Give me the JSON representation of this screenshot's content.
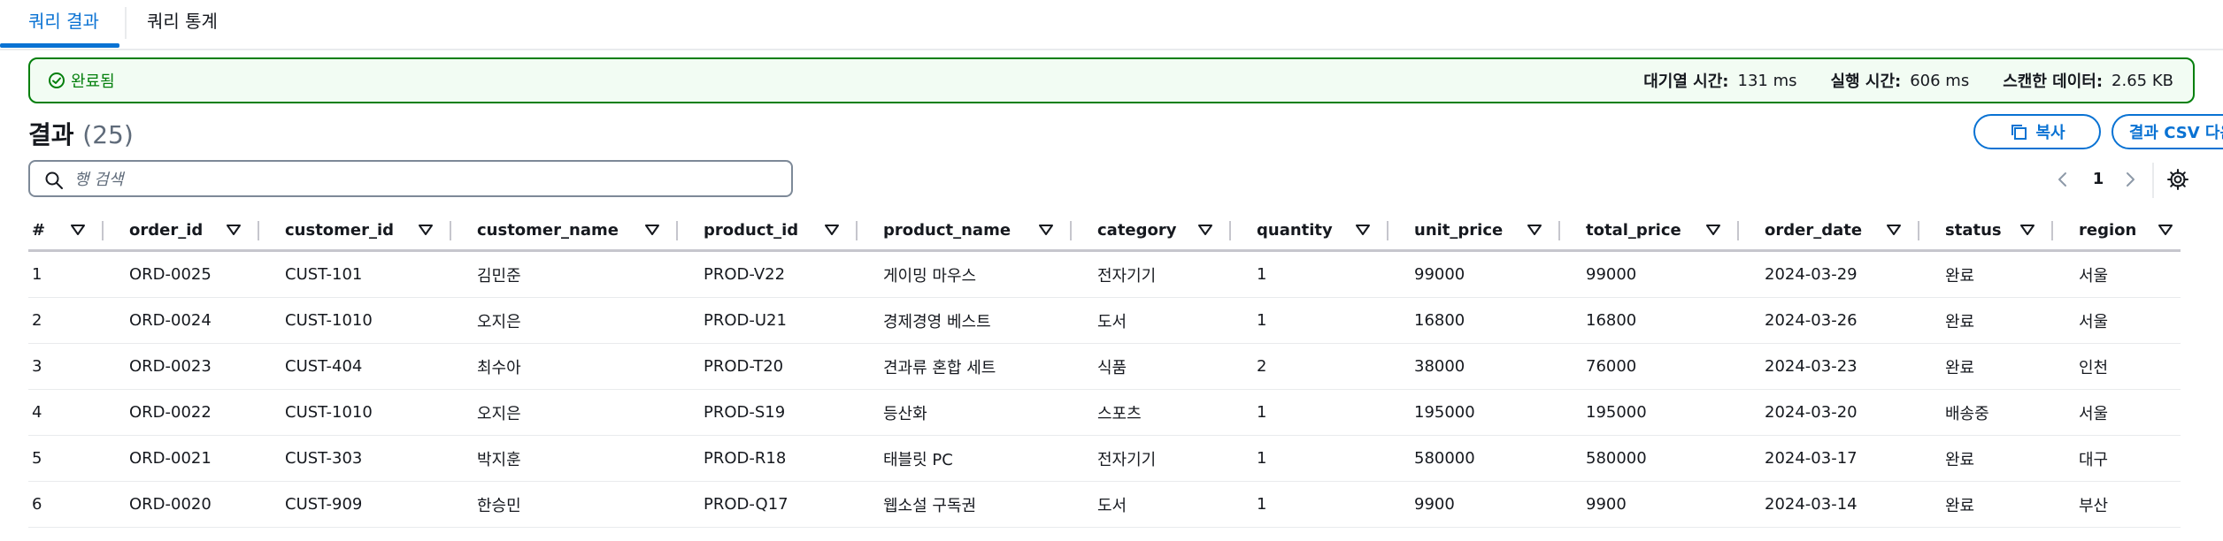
{
  "tabs": [
    {
      "label": "쿼리 결과",
      "active": true
    },
    {
      "label": "쿼리 통계",
      "active": false
    }
  ],
  "status": {
    "text": "완료됨",
    "queue_label": "대기열 시간:",
    "queue_value": "131 ms",
    "run_label": "실행 시간:",
    "run_value": "606 ms",
    "scan_label": "스캔한 데이터:",
    "scan_value": "2.65 KB",
    "color": "#037f0c"
  },
  "results": {
    "title": "결과",
    "count": "(25)",
    "copy_label": "복사",
    "download_label": "결과 CSV 다운로드"
  },
  "search": {
    "placeholder": "행 검색",
    "value": ""
  },
  "pagination": {
    "current_page": "1"
  },
  "table": {
    "columns": [
      "#",
      "order_id",
      "customer_id",
      "customer_name",
      "product_id",
      "product_name",
      "category",
      "quantity",
      "unit_price",
      "total_price",
      "order_date",
      "status",
      "region"
    ],
    "rows": [
      [
        "1",
        "ORD-0025",
        "CUST-101",
        "김민준",
        "PROD-V22",
        "게이밍 마우스",
        "전자기기",
        "1",
        "99000",
        "99000",
        "2024-03-29",
        "완료",
        "서울"
      ],
      [
        "2",
        "ORD-0024",
        "CUST-1010",
        "오지은",
        "PROD-U21",
        "경제경영 베스트",
        "도서",
        "1",
        "16800",
        "16800",
        "2024-03-26",
        "완료",
        "서울"
      ],
      [
        "3",
        "ORD-0023",
        "CUST-404",
        "최수아",
        "PROD-T20",
        "견과류 혼합 세트",
        "식품",
        "2",
        "38000",
        "76000",
        "2024-03-23",
        "완료",
        "인천"
      ],
      [
        "4",
        "ORD-0022",
        "CUST-1010",
        "오지은",
        "PROD-S19",
        "등산화",
        "스포츠",
        "1",
        "195000",
        "195000",
        "2024-03-20",
        "배송중",
        "서울"
      ],
      [
        "5",
        "ORD-0021",
        "CUST-303",
        "박지훈",
        "PROD-R18",
        "태블릿 PC",
        "전자기기",
        "1",
        "580000",
        "580000",
        "2024-03-17",
        "완료",
        "대구"
      ],
      [
        "6",
        "ORD-0020",
        "CUST-909",
        "한승민",
        "PROD-Q17",
        "웹소설 구독권",
        "도서",
        "1",
        "9900",
        "9900",
        "2024-03-14",
        "완료",
        "부산"
      ]
    ]
  },
  "colors": {
    "accent": "#0972d3",
    "success": "#037f0c",
    "success_bg": "#f2fcf3"
  }
}
